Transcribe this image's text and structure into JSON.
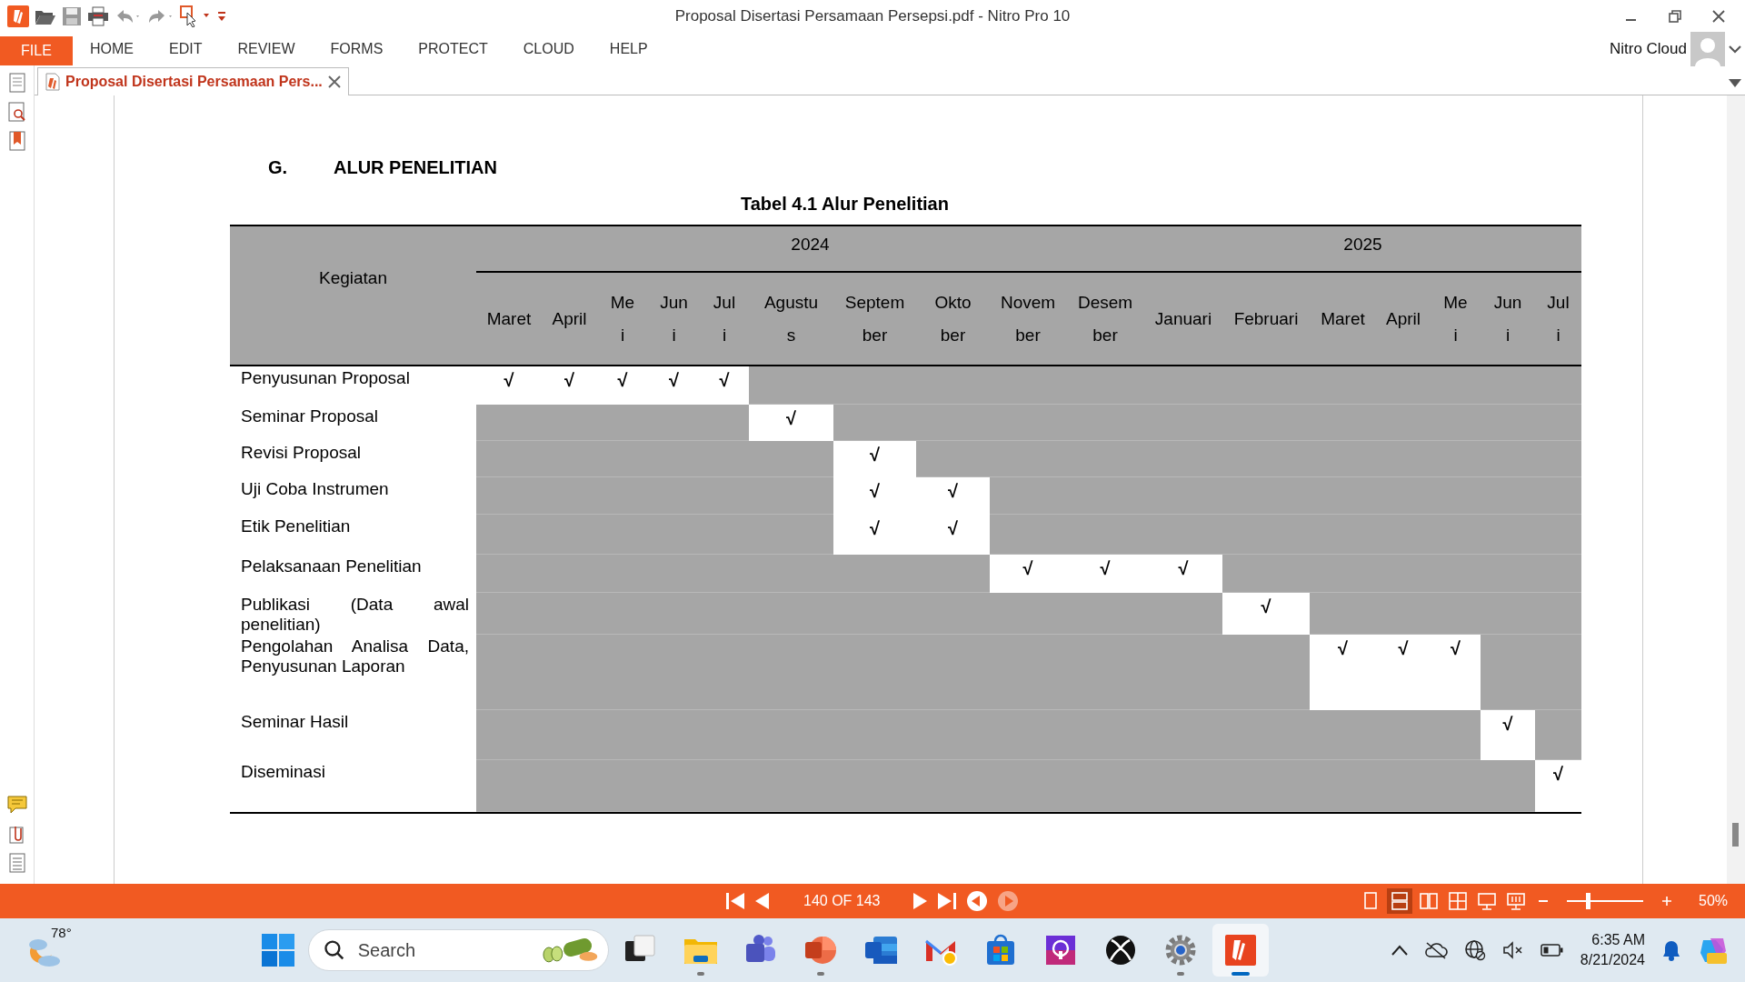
{
  "window": {
    "title": "Proposal Disertasi Persamaan Persepsi.pdf - Nitro Pro 10"
  },
  "ribbon": {
    "file_button": "FILE",
    "menu": [
      "HOME",
      "EDIT",
      "REVIEW",
      "FORMS",
      "PROTECT",
      "CLOUD",
      "HELP"
    ],
    "account": "Nitro Cloud"
  },
  "document_tab": {
    "title": "Proposal Disertasi Persamaan Pers..."
  },
  "page": {
    "section_number": "G.",
    "section_title": "ALUR PENELITIAN",
    "table_caption": "Tabel 4.1 Alur Penelitian",
    "table": {
      "corner_header": "Kegiatan",
      "check_symbol": "√",
      "years": [
        {
          "year": "2024",
          "months": [
            "Maret",
            "April",
            "Me\ni",
            "Jun\ni",
            "Jul\ni",
            "Agustu\ns",
            "Septem\nber",
            "Okto\nber",
            "Novem\nber",
            "Desem\nber"
          ]
        },
        {
          "year": "2025",
          "months": [
            "Januari",
            "Februari",
            "Maret",
            "April",
            "Me\ni",
            "Jun\ni",
            "Jul\ni"
          ]
        }
      ],
      "rows": [
        {
          "activity": "Penyusunan Proposal",
          "checked": [
            true,
            true,
            true,
            true,
            true,
            false,
            false,
            false,
            false,
            false,
            false,
            false,
            false,
            false,
            false,
            false,
            false
          ]
        },
        {
          "activity": "Seminar Proposal",
          "checked": [
            false,
            false,
            false,
            false,
            false,
            true,
            false,
            false,
            false,
            false,
            false,
            false,
            false,
            false,
            false,
            false,
            false
          ]
        },
        {
          "activity": "Revisi Proposal",
          "checked": [
            false,
            false,
            false,
            false,
            false,
            false,
            true,
            false,
            false,
            false,
            false,
            false,
            false,
            false,
            false,
            false,
            false
          ]
        },
        {
          "activity": "Uji Coba Instrumen",
          "checked": [
            false,
            false,
            false,
            false,
            false,
            false,
            true,
            true,
            false,
            false,
            false,
            false,
            false,
            false,
            false,
            false,
            false
          ]
        },
        {
          "activity": "Etik Penelitian",
          "checked": [
            false,
            false,
            false,
            false,
            false,
            false,
            true,
            true,
            false,
            false,
            false,
            false,
            false,
            false,
            false,
            false,
            false
          ]
        },
        {
          "activity": "Pelaksanaan Penelitian",
          "checked": [
            false,
            false,
            false,
            false,
            false,
            false,
            false,
            false,
            true,
            true,
            true,
            false,
            false,
            false,
            false,
            false,
            false
          ]
        },
        {
          "activity": "Publikasi (Data awal penelitian)",
          "checked": [
            false,
            false,
            false,
            false,
            false,
            false,
            false,
            false,
            false,
            false,
            false,
            true,
            false,
            false,
            false,
            false,
            false
          ]
        },
        {
          "activity": "Pengolahan Analisa Data, Penyusunan Laporan",
          "checked": [
            false,
            false,
            false,
            false,
            false,
            false,
            false,
            false,
            false,
            false,
            false,
            false,
            true,
            true,
            true,
            false,
            false
          ]
        },
        {
          "activity": "Seminar Hasil",
          "checked": [
            false,
            false,
            false,
            false,
            false,
            false,
            false,
            false,
            false,
            false,
            false,
            false,
            false,
            false,
            false,
            true,
            false
          ]
        },
        {
          "activity": "Diseminasi",
          "checked": [
            false,
            false,
            false,
            false,
            false,
            false,
            false,
            false,
            false,
            false,
            false,
            false,
            false,
            false,
            false,
            false,
            true
          ]
        }
      ]
    }
  },
  "status_bar": {
    "page_label": "140 OF 143",
    "history": [
      {
        "disabled": false
      },
      {
        "disabled": true
      }
    ],
    "view_modes": [
      {
        "selected": false
      },
      {
        "selected": true
      },
      {
        "selected": false
      },
      {
        "selected": false
      },
      {
        "selected": false
      },
      {
        "selected": false
      }
    ],
    "zoom": {
      "level": 0.25,
      "reading": "50%"
    }
  },
  "taskbar": {
    "weather": {
      "temperature": "78°"
    },
    "search": {
      "placeholder": "Search"
    },
    "apps": [
      {
        "kind": "task-view",
        "running": false,
        "active": false
      },
      {
        "kind": "explorer",
        "running": true,
        "active": false
      },
      {
        "kind": "teams",
        "running": false,
        "active": false
      },
      {
        "kind": "powerpoint",
        "running": true,
        "active": false
      },
      {
        "kind": "word",
        "running": false,
        "active": false
      },
      {
        "kind": "mail",
        "running": false,
        "active": false
      },
      {
        "kind": "store",
        "running": false,
        "active": false
      },
      {
        "kind": "podcast",
        "running": false,
        "active": false
      },
      {
        "kind": "xbox",
        "running": false,
        "active": false
      },
      {
        "kind": "settings",
        "running": true,
        "active": false
      },
      {
        "kind": "nitro",
        "running": true,
        "active": true
      }
    ],
    "tray": {
      "time": "6:35 AM",
      "date": "8/21/2024"
    }
  }
}
